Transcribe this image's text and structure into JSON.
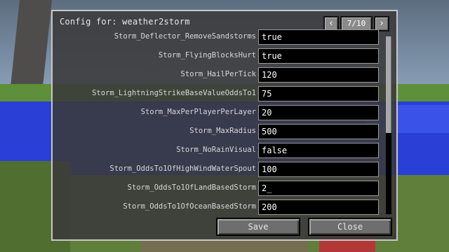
{
  "dialog": {
    "title": "Config for: weather2storm",
    "pager": {
      "prev_icon": "‹",
      "counter": "7/10",
      "next_icon": "›"
    },
    "rows": [
      {
        "label": "Storm_Deflector_RemoveSandstorms",
        "value": "true"
      },
      {
        "label": "Storm_FlyingBlocksHurt",
        "value": "true"
      },
      {
        "label": "Storm_HailPerTick",
        "value": "120"
      },
      {
        "label": "Storm_LightningStrikeBaseValueOddsTo1",
        "value": "75"
      },
      {
        "label": "Storm_MaxPerPlayerPerLayer",
        "value": "20"
      },
      {
        "label": "Storm_MaxRadius",
        "value": "500"
      },
      {
        "label": "Storm_NoRainVisual",
        "value": "false"
      },
      {
        "label": "Storm_OddsTo1OfHighWindWaterSpout",
        "value": "100"
      },
      {
        "label": "Storm_OddsTo1OfLandBasedStorm",
        "value": "2_"
      },
      {
        "label": "Storm_OddsTo1OfOceanBasedStorm",
        "value": "200"
      }
    ],
    "buttons": {
      "save": "Save",
      "close": "Close"
    }
  }
}
